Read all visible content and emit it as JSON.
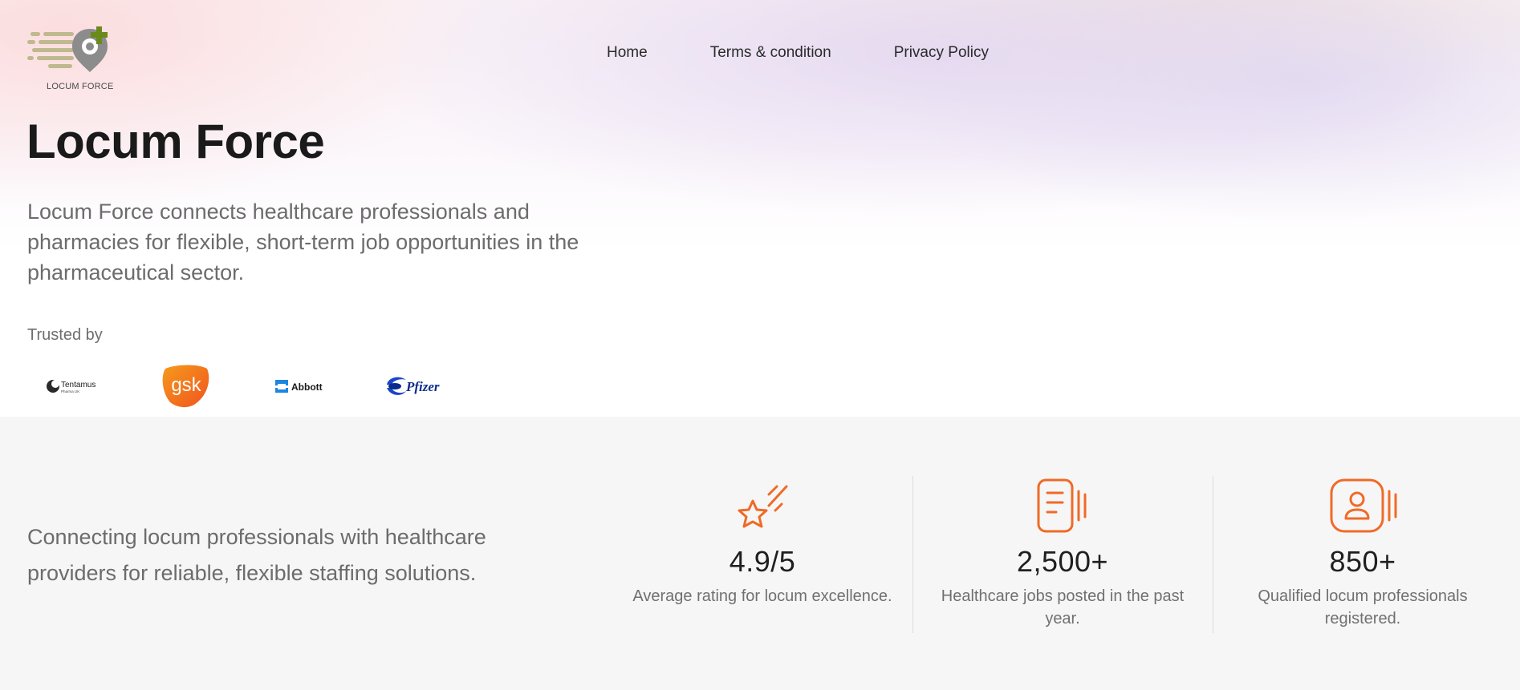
{
  "brand": {
    "logo_text": "LOCUM FORCE",
    "accent_color": "#f06a26",
    "logo_green": "#6a8a1c",
    "logo_khaki": "#bfb98f",
    "logo_gray": "#8c8c8c"
  },
  "nav": {
    "items": [
      {
        "label": "Home"
      },
      {
        "label": "Terms & condition"
      },
      {
        "label": "Privacy Policy"
      }
    ]
  },
  "hero": {
    "title": "Locum Force",
    "description": "Locum Force connects healthcare professionals and pharmacies for flexible, short-term job opportunities in the pharmaceutical sector.",
    "trusted_label": "Trusted by",
    "partners": [
      {
        "name": "Tentamus",
        "subtitle": "Pharma UK",
        "icon": "tentamus-logo"
      },
      {
        "name": "gsk",
        "icon": "gsk-logo"
      },
      {
        "name": "Abbott",
        "icon": "abbott-logo"
      },
      {
        "name": "Pfizer",
        "icon": "pfizer-logo"
      }
    ]
  },
  "stats_section": {
    "tagline": "Connecting locum professionals with healthcare providers for reliable, flexible staffing solutions.",
    "stats": [
      {
        "icon": "shooting-star-icon",
        "value": "4.9/5",
        "description": "Average rating for locum excellence."
      },
      {
        "icon": "document-list-icon",
        "value": "2,500+",
        "description": "Healthcare jobs posted in the past year."
      },
      {
        "icon": "user-profile-icon",
        "value": "850+",
        "description": "Qualified locum professionals registered."
      }
    ]
  }
}
